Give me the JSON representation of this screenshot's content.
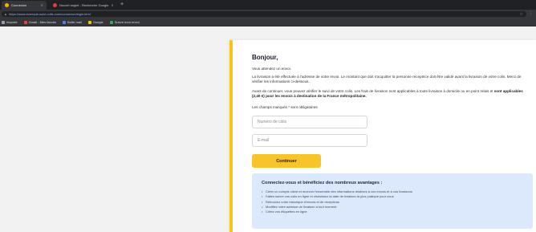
{
  "browser": {
    "tabs": [
      {
        "title": "Connexion",
        "favicon_color": "#f5b400"
      },
      {
        "title": "Nouvel onglet - Recherche Google",
        "favicon_color": "#e04040"
      }
    ],
    "new_tab_label": "+",
    "url": "https://www.exemple-suivi-colis.com/connexion/login.html",
    "bookmarks": [
      {
        "label": "Importé",
        "color": "#9aa0a6"
      },
      {
        "label": "Gmail - Mes favoris",
        "color": "#ea4335"
      },
      {
        "label": "Boîte mail",
        "color": "#4285f4"
      },
      {
        "label": "Google",
        "color": "#fbbc04"
      },
      {
        "label": "Suivre mon envoi",
        "color": "#34a853"
      }
    ]
  },
  "card": {
    "greeting": "Bonjour,",
    "intro": "Vous attendez un envoi.",
    "paragraph1": "La livraison a été effectuée à l'adresse de votre envoi. Le montant que doit s'acquitter la personne réceptrice doit être validé avant la livraison de votre colis. Merci de vérifier les informations ci-dessous.",
    "paragraph2_start": "Avant de continuer, vous pouvez vérifier le suivi de votre colis. Les frais de livraison sont applicables à toute livraison à domicile ou en point relais et",
    "paragraph2_bold": "sont applicables (2,40 €) pour les envois à destination de la France métropolitaine.",
    "required_note": "Les champs marqués * sont obligatoires",
    "tracking_placeholder": "Numéro de colis",
    "email_placeholder": "E-mail",
    "continue_label": "Continuer",
    "benefits_title": "Connectez-vous et bénéficiez des nombreux avantages :",
    "benefits": [
      "Créer un compte client et recevoir l'ensemble des informations relatives à vos envois et à vos livraisons",
      "Faites suivre vos colis en ligne et choisissez la date de livraison la plus pratique pour vous",
      "Retrouvez votre historique d'envois et de réceptions",
      "Modifiez votre adresse de livraison à tout moment",
      "Créez vos étiquettes en ligne"
    ],
    "accent_color": "#f5c518",
    "button_color": "#f8c42b",
    "benefits_bg": "#dce8fb"
  }
}
